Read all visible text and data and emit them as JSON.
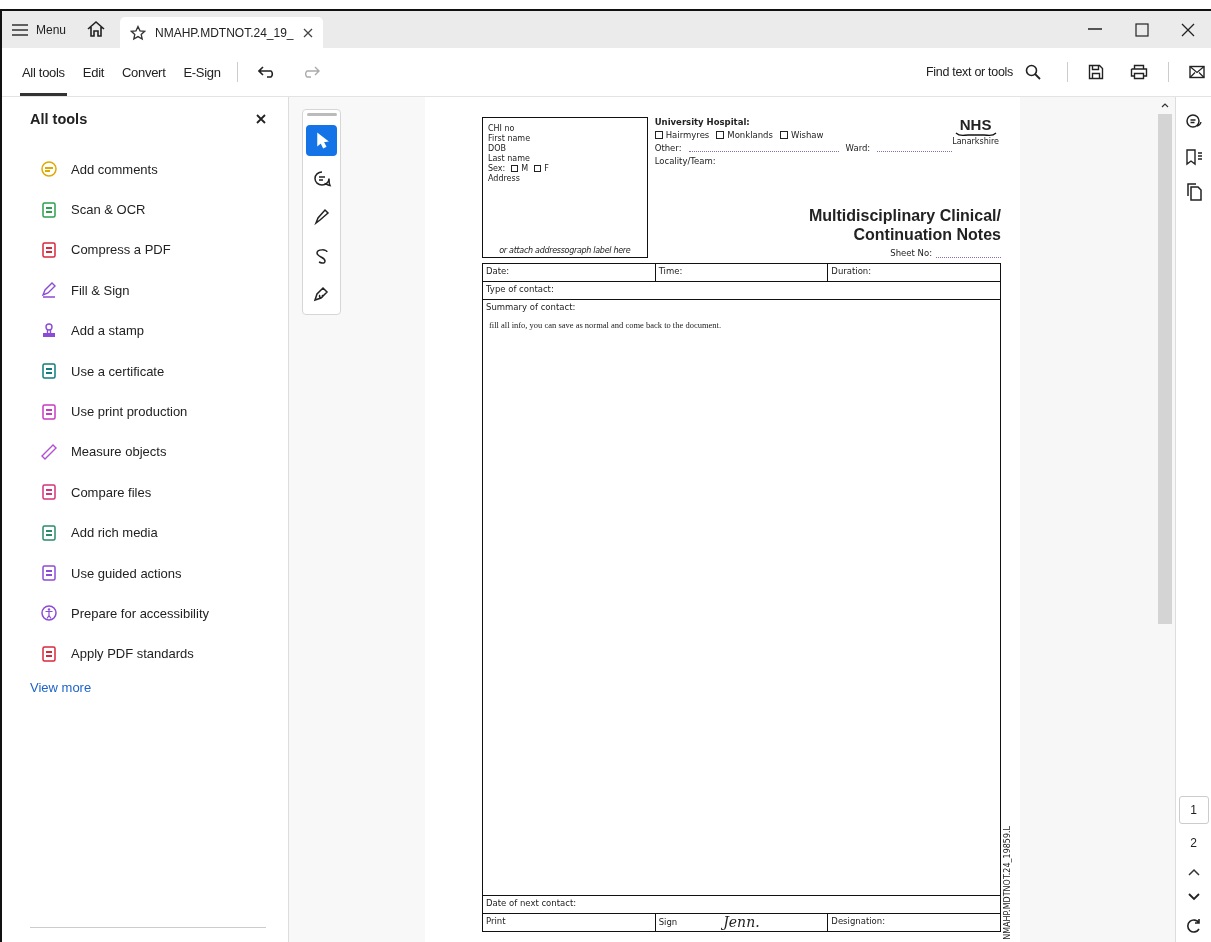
{
  "titlebar": {
    "menu": "Menu",
    "tabs": [
      {
        "title": "NMAHP.MDTNOT.24_19_",
        "selected": true
      }
    ]
  },
  "toolbar": {
    "tabs": [
      {
        "label": "All tools",
        "selected": true
      },
      {
        "label": "Edit",
        "selected": false
      },
      {
        "label": "Convert",
        "selected": false
      },
      {
        "label": "E-Sign",
        "selected": false
      }
    ],
    "find": "Find text or tools"
  },
  "panel": {
    "title": "All tools",
    "items": [
      {
        "label": "Add comments",
        "color": "#e0a800"
      },
      {
        "label": "Scan & OCR",
        "color": "#2e9e4f"
      },
      {
        "label": "Compress a PDF",
        "color": "#d8283b"
      },
      {
        "label": "Fill & Sign",
        "color": "#8c4bd6"
      },
      {
        "label": "Add a stamp",
        "color": "#8c4bd6"
      },
      {
        "label": "Use a certificate",
        "color": "#117c7c"
      },
      {
        "label": "Use print production",
        "color": "#c73bc0"
      },
      {
        "label": "Measure objects",
        "color": "#b04fd1"
      },
      {
        "label": "Compare files",
        "color": "#d4327c"
      },
      {
        "label": "Add rich media",
        "color": "#2a8b6a"
      },
      {
        "label": "Use guided actions",
        "color": "#8c4bd6"
      },
      {
        "label": "Prepare for accessibility",
        "color": "#8c4bd6"
      },
      {
        "label": "Apply PDF standards",
        "color": "#d8283b"
      }
    ],
    "view_more": "View more"
  },
  "rail_tools": [
    {
      "selected": true
    },
    {
      "selected": false
    },
    {
      "selected": false
    },
    {
      "selected": false
    },
    {
      "selected": false
    }
  ],
  "document": {
    "patient_box": {
      "fields": [
        "CHI no",
        "First name",
        "DOB",
        "Last name"
      ],
      "sex_label": "Sex:",
      "sex_options": [
        {
          "label": "M",
          "checked": false
        },
        {
          "label": "F",
          "checked": false
        }
      ],
      "address": "Address",
      "note": "or attach addressograph label here"
    },
    "hospital": {
      "label": "University Hospital:",
      "options": [
        {
          "label": "Hairmyres",
          "checked": false
        },
        {
          "label": "Monklands",
          "checked": false
        },
        {
          "label": "Wishaw",
          "checked": false
        }
      ],
      "other": "Other:",
      "ward": "Ward:",
      "locality": "Locality/Team:"
    },
    "logo": {
      "mark": "NHS",
      "region": "Lanarkshire"
    },
    "title_lines": [
      "Multidisciplinary Clinical/",
      "Continuation Notes"
    ],
    "sheet_no": "Sheet No:",
    "row1": [
      "Date:",
      "Time:",
      "Duration:"
    ],
    "type_of_contact": "Type of contact:",
    "summary_label": "Summary of contact:",
    "summary_text": "fill all info, you can save as normal and come back to the document.",
    "next_contact": "Date of next contact:",
    "print": "Print",
    "sign": "Sign",
    "signature": "Jenn.",
    "designation": "Designation:",
    "form_code": "NMAHP.MDTNOT.24_19859.L"
  },
  "page_nav": [
    {
      "label": "1",
      "selected": true
    },
    {
      "label": "2",
      "selected": false
    }
  ]
}
